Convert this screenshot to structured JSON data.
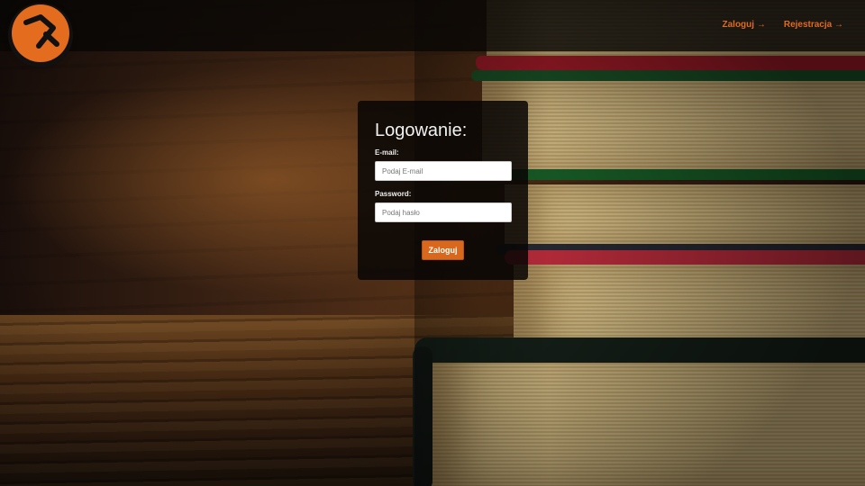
{
  "app": {
    "logo_icon": "brand-logo-icon",
    "accent_color": "#e06a1f"
  },
  "nav": {
    "login_label": "Zaloguj",
    "register_label": "Rejestracja",
    "arrow_icon": "arrow-right-icon"
  },
  "login_form": {
    "title": "Logowanie:",
    "email_label": "E-mail:",
    "email_placeholder": "Podaj E-mail",
    "email_value": "",
    "password_label": "Password:",
    "password_placeholder": "Podaj hasło",
    "password_value": "",
    "submit_label": "Zaloguj"
  }
}
